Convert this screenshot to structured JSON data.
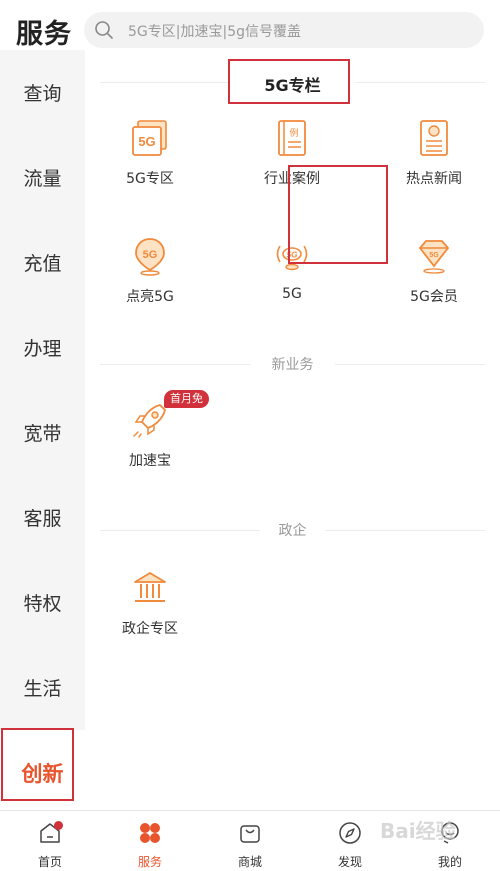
{
  "header": {
    "title": "服务",
    "search_placeholder": "5G专区|加速宝|5g信号覆盖"
  },
  "sidebar": {
    "items": [
      {
        "label": "查询"
      },
      {
        "label": "流量"
      },
      {
        "label": "充值"
      },
      {
        "label": "办理"
      },
      {
        "label": "宽带"
      },
      {
        "label": "客服"
      },
      {
        "label": "特权"
      },
      {
        "label": "生活"
      },
      {
        "label": "创新"
      }
    ],
    "active_index": 8
  },
  "sections": {
    "s5g": {
      "title": "5G专栏",
      "tiles": [
        {
          "label": "5G专区",
          "icon": "5g-zone-icon"
        },
        {
          "label": "行业案例",
          "icon": "case-book-icon"
        },
        {
          "label": "热点新闻",
          "icon": "news-icon"
        },
        {
          "label": "点亮5G",
          "icon": "location-5g-icon"
        },
        {
          "label": "5G",
          "icon": "5g-signal-icon"
        },
        {
          "label": "5G会员",
          "icon": "diamond-5g-icon"
        }
      ]
    },
    "new_business": {
      "title": "新业务",
      "tiles": [
        {
          "label": "加速宝",
          "icon": "rocket-icon",
          "badge": "首月免"
        }
      ]
    },
    "gov": {
      "title": "政企",
      "tiles": [
        {
          "label": "政企专区",
          "icon": "bank-icon"
        }
      ]
    }
  },
  "bottom_nav": [
    {
      "label": "首页",
      "icon": "home-icon"
    },
    {
      "label": "服务",
      "icon": "service-grid-icon"
    },
    {
      "label": "商城",
      "icon": "shopping-bag-icon"
    },
    {
      "label": "发现",
      "icon": "compass-icon"
    },
    {
      "label": "我的",
      "icon": "profile-icon"
    }
  ],
  "watermark": "Bai经验",
  "colors": {
    "accent": "#e8542c",
    "highlight_box": "#d0313a",
    "icon_orange": "#f08a3c"
  }
}
